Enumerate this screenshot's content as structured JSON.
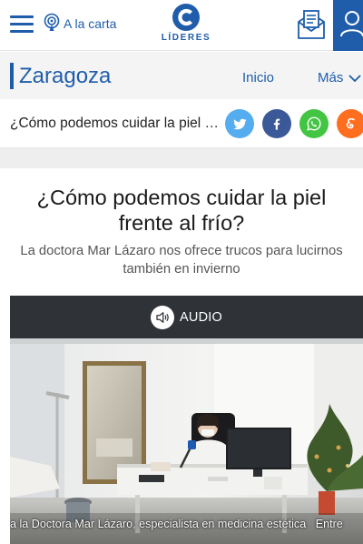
{
  "header": {
    "menu_icon": "hamburger-icon",
    "podcast_label": "A la carta",
    "podcast_icon": "podcast-icon",
    "logo_icon": "cope-logo-icon",
    "logo_text": "LÍDERES",
    "newsletter_icon": "newsletter-icon",
    "user_icon": "user-icon"
  },
  "station": {
    "name": "Zaragoza",
    "nav": [
      "Inicio",
      "Más"
    ],
    "chevron_icon": "chevron-down-icon"
  },
  "share": {
    "title": "¿Cómo podemos cuidar la piel frente al frío?",
    "buttons": [
      {
        "icon": "twitter-icon",
        "color": "#55acee"
      },
      {
        "icon": "facebook-icon",
        "color": "#3b5998"
      },
      {
        "icon": "whatsapp-icon",
        "color": "#43c544"
      },
      {
        "icon": "meneame-icon",
        "color": "#ff6d1f"
      }
    ]
  },
  "article": {
    "headline": "¿Cómo podemos cuidar la piel frente al frío?",
    "subtitle": "La doctora Mar Lázaro nos ofrece trucos para lucirnos también en invierno"
  },
  "player": {
    "label": "AUDIO",
    "icon": "speaker-icon",
    "caption": "a la Doctora Mar Lázaro, especialista en medicina estética",
    "caption_next": "Entre"
  },
  "colors": {
    "brand": "#1f5dab",
    "player_bg": "#2f3237"
  }
}
